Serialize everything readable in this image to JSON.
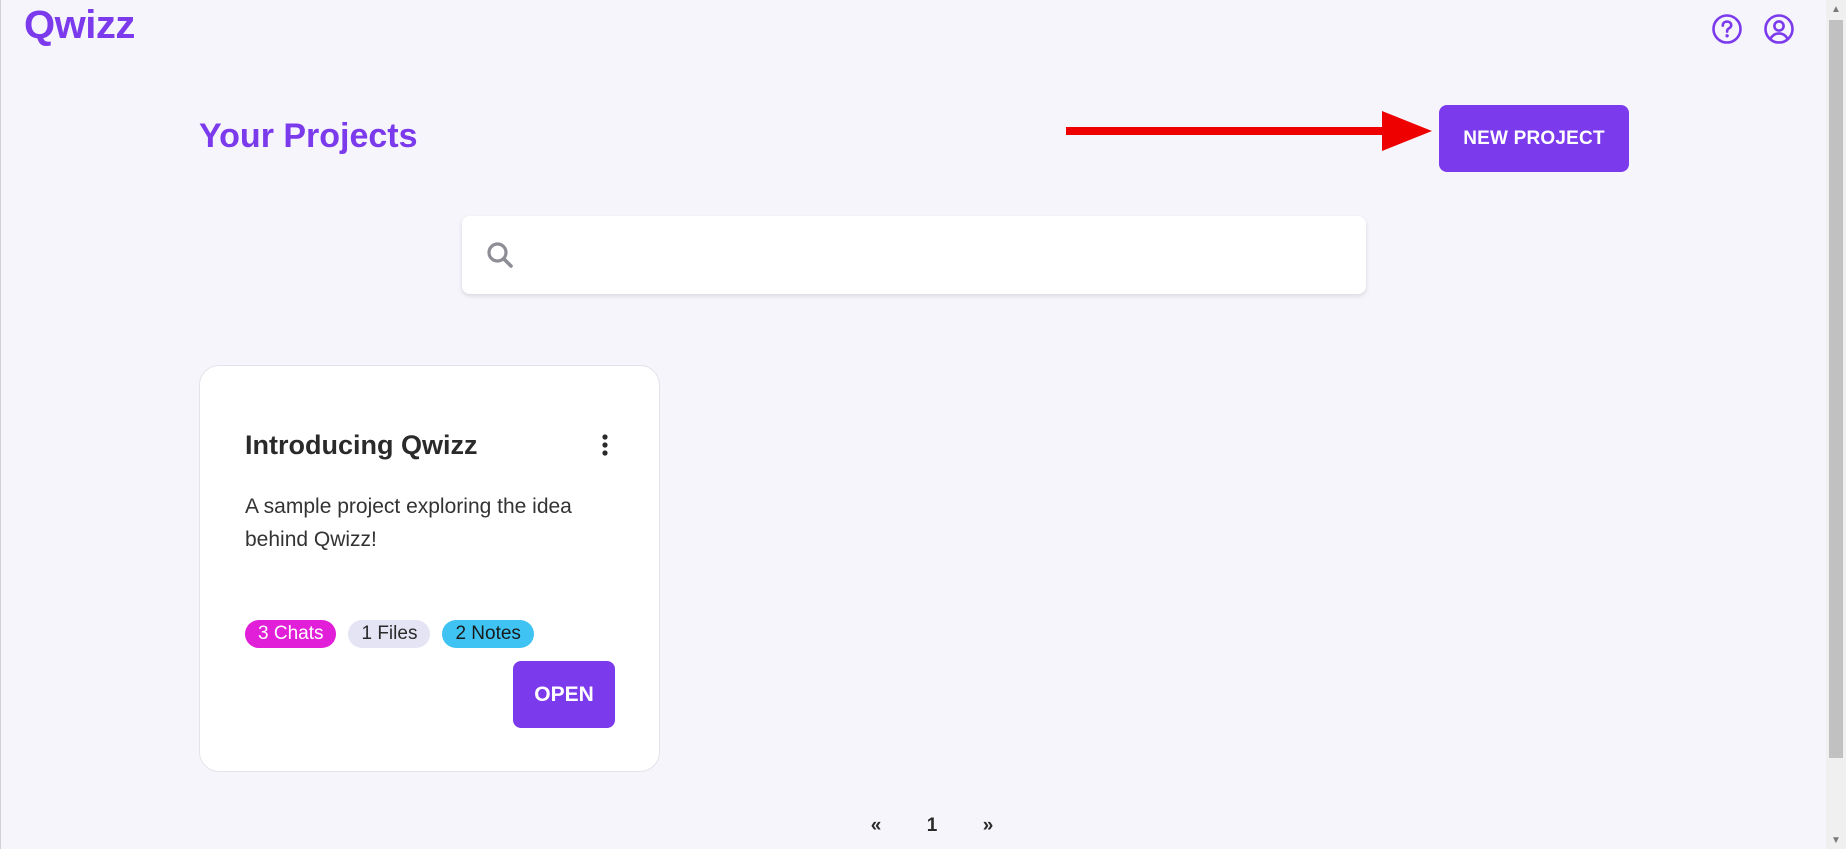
{
  "app": {
    "brand": "Qwizz"
  },
  "header": {
    "icons": [
      "help-circle-icon",
      "user-circle-icon"
    ]
  },
  "main": {
    "title": "Your Projects",
    "new_project_label": "NEW PROJECT",
    "search": {
      "placeholder": "",
      "value": ""
    },
    "projects": [
      {
        "title": "Introducing Qwizz",
        "description": "A sample project exploring the idea behind Qwizz!",
        "badges": {
          "chats": "3 Chats",
          "files": "1 Files",
          "notes": "2 Notes"
        },
        "open_label": "OPEN"
      }
    ]
  },
  "pagination": {
    "prev": "«",
    "current": "1",
    "next": "»"
  },
  "colors": {
    "accent": "#7c3aed",
    "chats_badge": "#e11fd8",
    "files_badge": "#e4e4f4",
    "notes_badge": "#3ec3f2",
    "annotation_arrow": "#ee0000"
  }
}
